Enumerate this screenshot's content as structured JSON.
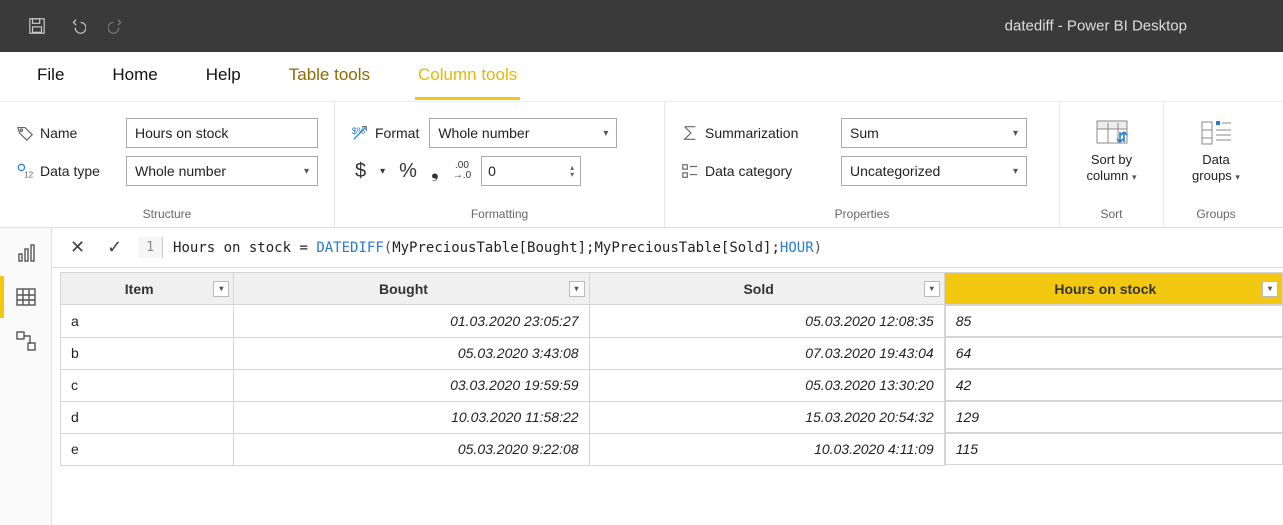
{
  "titlebar": {
    "title": "datediff - Power BI Desktop"
  },
  "menubar": {
    "tabs": [
      {
        "label": "File",
        "kind": "normal"
      },
      {
        "label": "Home",
        "kind": "normal"
      },
      {
        "label": "Help",
        "kind": "normal"
      },
      {
        "label": "Table tools",
        "kind": "sub"
      },
      {
        "label": "Column tools",
        "kind": "active"
      }
    ]
  },
  "ribbon": {
    "structure": {
      "name_label": "Name",
      "name_value": "Hours on stock",
      "type_label": "Data type",
      "type_value": "Whole number",
      "group": "Structure"
    },
    "formatting": {
      "format_label": "Format",
      "format_value": "Whole number",
      "decimals": "0",
      "group": "Formatting"
    },
    "properties": {
      "summ_label": "Summarization",
      "summ_value": "Sum",
      "cat_label": "Data category",
      "cat_value": "Uncategorized",
      "group": "Properties"
    },
    "sort": {
      "btn1_line1": "Sort by",
      "btn1_line2": "column",
      "group": "Sort"
    },
    "groups": {
      "btn1_line1": "Data",
      "btn1_line2": "groups",
      "group": "Groups"
    }
  },
  "formula": {
    "line": "1",
    "lhs": "Hours on stock = ",
    "fn": "DATEDIFF",
    "args_mid": "MyPreciousTable[Bought];MyPreciousTable[Sold];",
    "kw": "HOUR"
  },
  "table": {
    "columns": [
      "Item",
      "Bought",
      "Sold",
      "Hours on stock"
    ],
    "rows": [
      {
        "item": "a",
        "bought": "01.03.2020 23:05:27",
        "sold": "05.03.2020 12:08:35",
        "hours": "85"
      },
      {
        "item": "b",
        "bought": "05.03.2020 3:43:08",
        "sold": "07.03.2020 19:43:04",
        "hours": "64"
      },
      {
        "item": "c",
        "bought": "03.03.2020 19:59:59",
        "sold": "05.03.2020 13:30:20",
        "hours": "42"
      },
      {
        "item": "d",
        "bought": "10.03.2020 11:58:22",
        "sold": "15.03.2020 20:54:32",
        "hours": "129"
      },
      {
        "item": "e",
        "bought": "05.03.2020 9:22:08",
        "sold": "10.03.2020 4:11:09",
        "hours": "115"
      }
    ]
  }
}
